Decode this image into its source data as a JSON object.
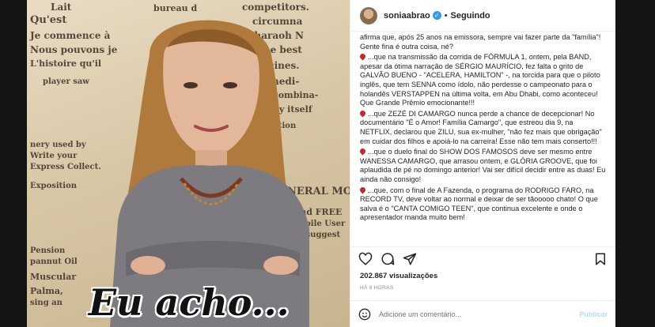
{
  "post": {
    "overlay_text": "Eu acho...",
    "newsprint": [
      "Qu'est",
      "Je commence à",
      "Nous pouvons je",
      "L'histoire qu'il",
      "competitors.",
      "circumna",
      "or Pharaoh N",
      "of the best",
      "two medi-",
      "use in combina-",
      "f used by itself",
      "nery used by",
      "Write your",
      "Express Collect.",
      "GENERAL MO",
      "send FREE",
      "utomobile User",
      "calgl suggest",
      "Pension",
      "pannut Oil",
      "Muscular",
      "Palma,",
      "sing an",
      "Lait",
      "bureau d",
      "medicines.",
      "player saw",
      "Exposition",
      "combination"
    ]
  },
  "side": {
    "username": "soniaabrao",
    "separator": "•",
    "follow_status": "Seguindo",
    "paragraphs": [
      {
        "pin": false,
        "text": "afirma que, após 25 anos na emissora, sempre vai fazer parte da \"família\"! Gente fina é outra coisa, né?"
      },
      {
        "pin": true,
        "text": "...que na transmissão da corrida de FÓRMULA 1, ontem, pela BAND, apesar da ótima narração de SÉRGIO MAURÍCIO, fez falta o grito de GALVÃO BUENO - \"ACELERA, HAMILTON\" -, na torcida para que o piloto inglês, que tem SENNA como ídolo, não perdesse o campeonato para o holandês VERSTAPPEN na última volta, em Abu Dhabi, como aconteceu! Que Grande Prêmio emocionante!!!"
      },
      {
        "pin": true,
        "text": "...que ZEZÉ DI CAMARGO nunca perde a chance de decepcionar! No documentário \"É o Amor! Família Camargo\", que estreou dia 9, na NETFLIX, declarou que ZILU, sua ex-mulher, \"não fez mais que obrigação\" em cuidar dos filhos e apoiá-lo na carreira! Esse não tem mais conserto!!!"
      },
      {
        "pin": true,
        "text": "...que o duelo final do SHOW DOS FAMOSOS deve ser mesmo entre WANESSA CAMARGO, que arrasou ontem, e GLÓRIA GROOVE, que foi aplaudida de pé no domingo anterior! Vai ser difícil decidir entre as duas! Eu ainda não consigo!"
      },
      {
        "pin": true,
        "text": "...que, com o final de A Fazenda, o programa do RODRIGO FARO, na RECORD TV, deve voltar ao normal e deixar de ser tãooooo chato! O que salva é o \"CANTA COMIGO TEEN\", que continua excelente e onde o apresentador manda muito bem!"
      }
    ],
    "views": "202.867 visualizações",
    "time_ago": "HÁ 8 HORAS",
    "comment_placeholder": "Adicione um comentário...",
    "publish_label": "Publicar"
  }
}
